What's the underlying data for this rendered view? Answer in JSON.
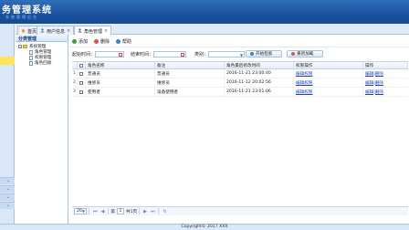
{
  "header": {
    "title": "务管理系统",
    "subtitle": "系统管理后台"
  },
  "tabs": [
    {
      "label": "首页",
      "icon": "home-icon"
    },
    {
      "label": "用户信息",
      "icon": "user-icon"
    },
    {
      "label": "角色管理",
      "icon": "role-icon",
      "active": true
    }
  ],
  "sidebar": {
    "title": "分类管理",
    "tree": {
      "root": "系统管理",
      "children": [
        "角色管理",
        "权限管理",
        "角色回收"
      ]
    }
  },
  "toolbar": {
    "add": "添加",
    "delete": "删除",
    "help": "帮助"
  },
  "search": {
    "start_label": "起始时间：",
    "end_label": "结束时间：",
    "type_label": "类别：",
    "start_value": "",
    "end_value": "",
    "type_value": "",
    "search_button": "开始检索",
    "reset_button": "重新加载"
  },
  "grid": {
    "headers": [
      "角色名称",
      "备注",
      "角色最后修改时间",
      "权限操作",
      "操作"
    ],
    "rows": [
      {
        "num": "1",
        "name": "普通员",
        "note": "普通员",
        "time": "2016-11-21 23:00:40",
        "perm": "编辑权限",
        "op": "编辑|删除"
      },
      {
        "num": "2",
        "name": "维修员",
        "note": "维修员",
        "time": "2016-11-12 20:02:56",
        "perm": "编辑权限",
        "op": "编辑|删除"
      },
      {
        "num": "3",
        "name": "使用者",
        "note": "设备使用者",
        "time": "2016-11-21 23:01:06",
        "perm": "编辑权限",
        "op": "编辑|删除"
      }
    ]
  },
  "pager": {
    "page_size": "20",
    "page_prefix": "第",
    "current_page": "1",
    "page_suffix": "共1页"
  },
  "footer": {
    "copyright": "Copyright© 2017 XXX"
  },
  "colors": {
    "header_blue": "#1a52a0",
    "link_blue": "#1c3ec4",
    "highlight_yellow": "#ffe35b"
  }
}
